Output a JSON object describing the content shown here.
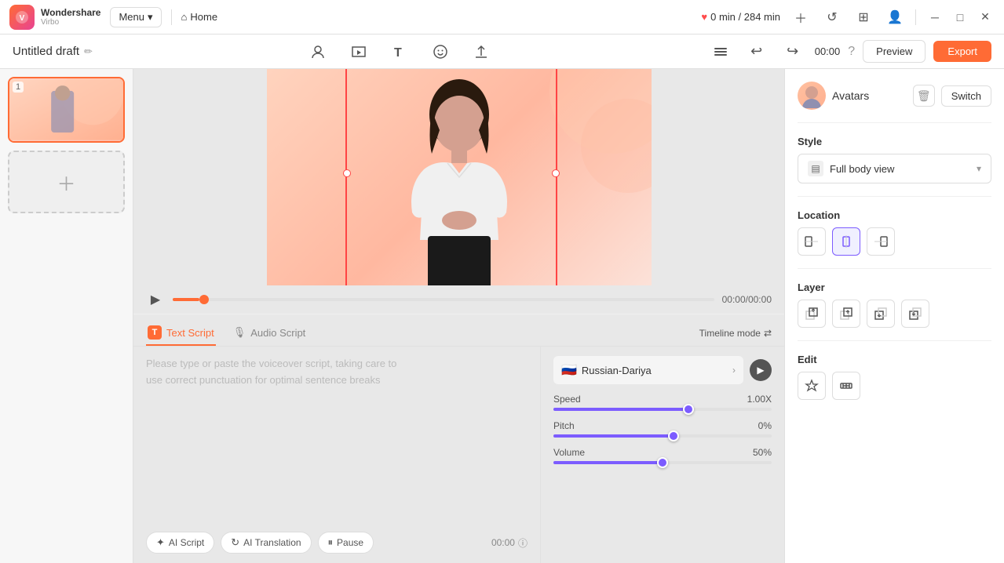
{
  "app": {
    "logo_line1": "Wondershare",
    "logo_line2": "Virbo",
    "menu_label": "Menu",
    "home_label": "Home",
    "time_display": "0 min / 284 min"
  },
  "title_bar": {
    "draft_name": "Untitled draft",
    "timestamp": "00:00",
    "preview_label": "Preview",
    "export_label": "Export"
  },
  "right_panel": {
    "avatars_label": "Avatars",
    "switch_label": "Switch",
    "style_section": "Style",
    "style_value": "Full body view",
    "location_section": "Location",
    "layer_section": "Layer",
    "edit_section": "Edit"
  },
  "timeline": {
    "time_counter": "00:00/00:00",
    "timeline_mode_label": "Timeline mode"
  },
  "script": {
    "text_script_tab": "Text Script",
    "audio_script_tab": "Audio Script",
    "placeholder_line1": "Please type or paste the voiceover script, taking care to",
    "placeholder_line2": "use correct punctuation for optimal sentence breaks",
    "ai_script_label": "AI Script",
    "ai_translation_label": "AI Translation",
    "pause_label": "Pause",
    "script_time": "00:00"
  },
  "audio": {
    "voice_name": "Russian-Dariya",
    "speed_label": "Speed",
    "speed_value": "1.00X",
    "pitch_label": "Pitch",
    "pitch_value": "0%",
    "volume_label": "Volume",
    "volume_value": "50%",
    "speed_fill_pct": 62,
    "pitch_fill_pct": 55,
    "volume_fill_pct": 50
  },
  "slides": [
    {
      "number": "1"
    }
  ]
}
